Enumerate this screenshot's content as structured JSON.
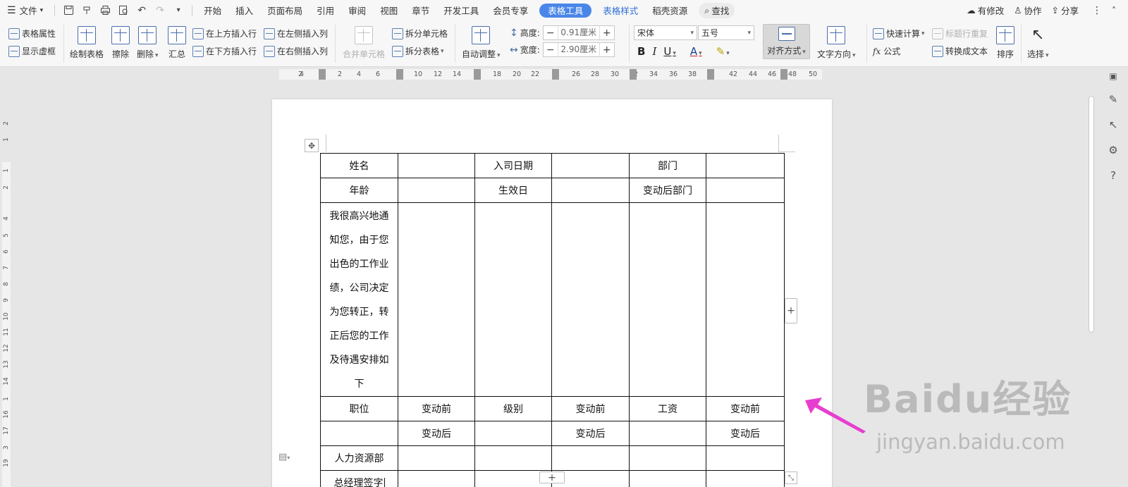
{
  "menubar": {
    "file": "文件",
    "tabs": [
      "开始",
      "插入",
      "页面布局",
      "引用",
      "审阅",
      "视图",
      "章节",
      "开发工具",
      "会员专享"
    ],
    "active_tab": "表格工具",
    "blue_tabs": [
      "表格样式"
    ],
    "after_tabs": [
      "稻壳资源"
    ],
    "search": "查找",
    "right": [
      "有修改",
      "协作",
      "分享"
    ]
  },
  "ribbon": {
    "table_props": "表格属性",
    "show_gridlines": "显示虚框",
    "draw_table": "绘制表格",
    "erase": "擦除",
    "delete": "删除",
    "summary": "汇总",
    "insert_above": "在上方插入行",
    "insert_below": "在下方插入行",
    "insert_left": "在左侧插入列",
    "insert_right": "在右侧插入列",
    "merge_cells": "合并单元格",
    "split_cells": "拆分单元格",
    "split_table": "拆分表格",
    "auto_fit": "自动调整",
    "height_label": "高度:",
    "height_value": "0.91厘米",
    "width_label": "宽度:",
    "width_value": "2.90厘米",
    "font_name": "宋体",
    "font_size": "五号",
    "align": "对齐方式",
    "text_direction": "文字方向",
    "quick_calc": "快速计算",
    "repeat_header": "标题行重复",
    "formula": "公式",
    "convert_text": "转换成文本",
    "sort": "排序",
    "select": "选择"
  },
  "ruler": {
    "top": [
      "4",
      "2",
      "2",
      "4",
      "6",
      "10",
      "12",
      "14",
      "18",
      "20",
      "22",
      "26",
      "28",
      "30",
      "32",
      "34",
      "36",
      "38",
      "42",
      "44",
      "46",
      "48",
      "50"
    ],
    "left": [
      "2",
      "1",
      "1",
      "2",
      "4",
      "5",
      "6",
      "7",
      "8",
      "9",
      "10",
      "11",
      "12",
      "13",
      "14",
      "1",
      "16",
      "17",
      "3",
      "19"
    ]
  },
  "table": {
    "r1": [
      "姓名",
      "",
      "入司日期",
      "",
      "部门",
      ""
    ],
    "r2": [
      "年龄",
      "",
      "生效日",
      "",
      "变动后部门",
      ""
    ],
    "r3_text": "我很高兴地通知您，由于您出色的工作业绩，公司决定为您转正，转正后您的工作及待遇安排如下",
    "r4": [
      "职位",
      "变动前",
      "级别",
      "变动前",
      "工资",
      "变动前"
    ],
    "r5": [
      "",
      "变动后",
      "",
      "变动后",
      "",
      "变动后"
    ],
    "r6": [
      "人力资源部",
      "",
      "",
      "",
      "",
      ""
    ],
    "r7": [
      "总经理签字",
      "",
      "",
      "",
      "",
      ""
    ]
  },
  "watermark": {
    "brand": "Baidu经验",
    "url": "jingyan.baidu.com"
  },
  "colors": {
    "accent": "#4a86e8",
    "arrow": "#e83ecf"
  }
}
